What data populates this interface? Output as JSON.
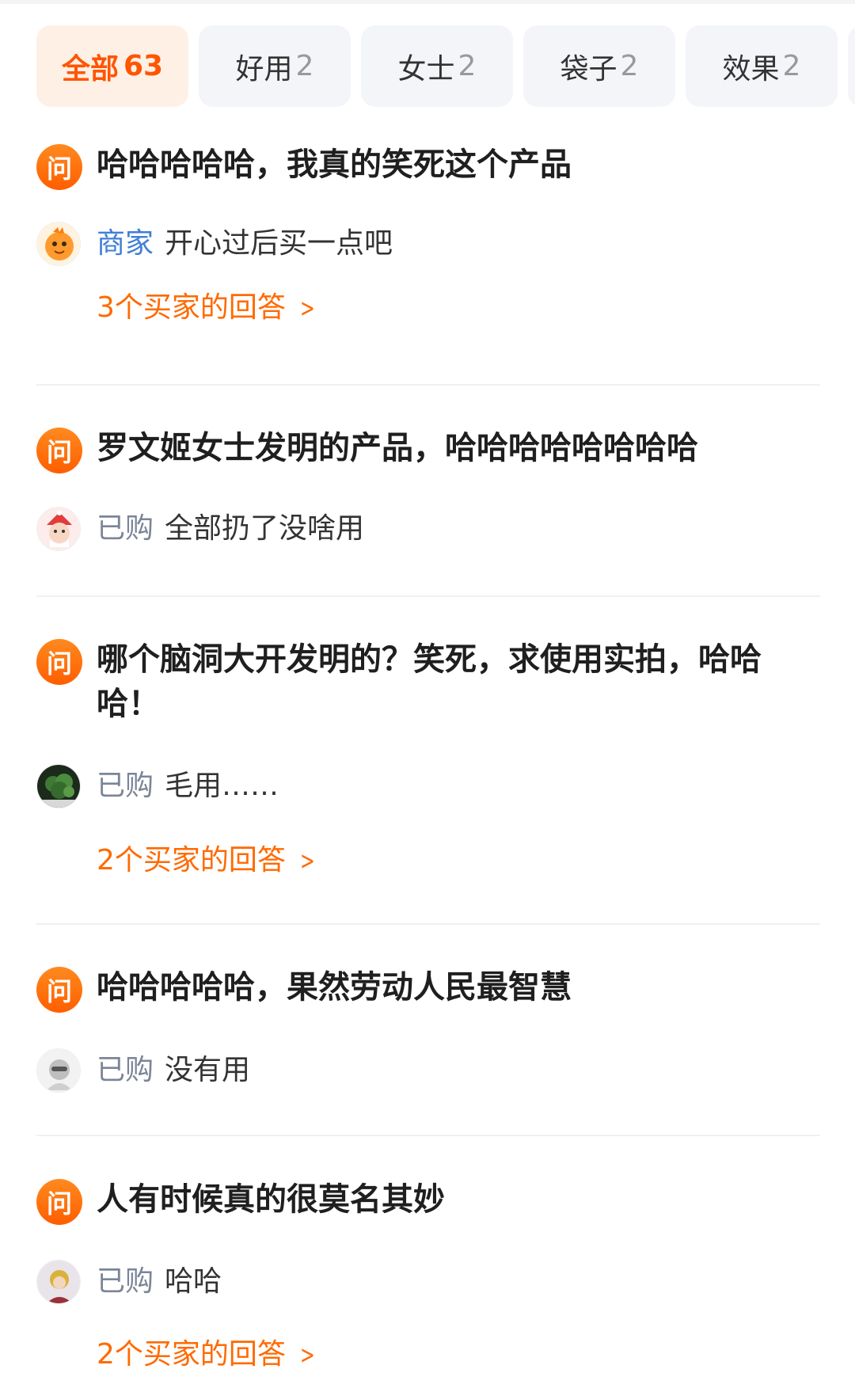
{
  "tabs": [
    {
      "label": "全部",
      "count": "63",
      "active": true
    },
    {
      "label": "好用",
      "count": "2"
    },
    {
      "label": "女士",
      "count": "2"
    },
    {
      "label": "袋子",
      "count": "2"
    },
    {
      "label": "效果",
      "count": "2"
    }
  ],
  "question_badge": "问",
  "questions": [
    {
      "question": "哈哈哈哈哈，我真的笑死这个产品",
      "answer_tag": "商家",
      "answer": "开心过后买一点吧",
      "more": "3个买家的回答"
    },
    {
      "question": "罗文姬女士发明的产品，哈哈哈哈哈哈哈哈",
      "answer_tag": "已购",
      "answer": "全部扔了没啥用"
    },
    {
      "question": "哪个脑洞大开发明的？笑死，求使用实拍，哈哈哈！",
      "answer_tag": "已购",
      "answer": "毛用……",
      "more": "2个买家的回答"
    },
    {
      "question": "哈哈哈哈哈，果然劳动人民最智慧",
      "answer_tag": "已购",
      "answer": "没有用"
    },
    {
      "question": "人有时候真的很莫名其妙",
      "answer_tag": "已购",
      "answer": "哈哈",
      "more": "2个买家的回答"
    }
  ],
  "colors": {
    "accent": "#ff6a00",
    "merchant": "#3f7fd6",
    "buyer_tag": "#7a8597"
  },
  "icons": {
    "question_badge": "question-badge-icon",
    "more_arrow": "chevron-right-icon"
  }
}
